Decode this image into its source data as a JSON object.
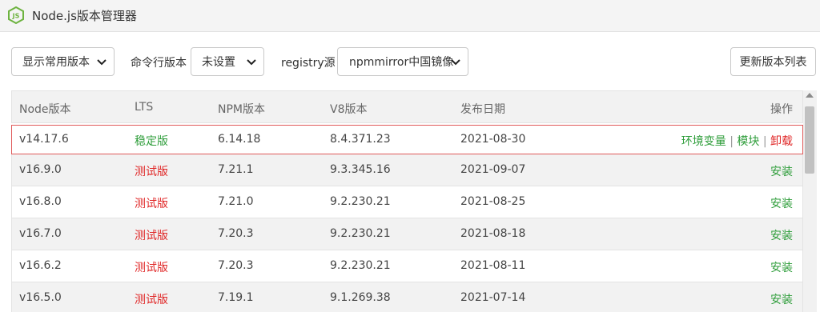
{
  "window": {
    "title": "Node.js版本管理器",
    "icon": "nodejs-hexagon-icon"
  },
  "toolbar": {
    "version_filter": "显示常用版本",
    "cli_label": "命令行版本",
    "cli_value": "未设置",
    "registry_label": "registry源",
    "registry_value": "npmmirror中国镜像",
    "refresh_label": "更新版本列表"
  },
  "table": {
    "headers": {
      "node": "Node版本",
      "lts": "LTS",
      "npm": "NPM版本",
      "v8": "V8版本",
      "date": "发布日期",
      "action": "操作"
    },
    "rows": [
      {
        "node": "v14.17.6",
        "lts": "稳定版",
        "npm": "6.14.18",
        "v8": "8.4.371.23",
        "date": "2021-08-30",
        "env": "环境变量",
        "module": "模块",
        "uninstall": "卸载",
        "sep1": "|",
        "sep2": "|"
      },
      {
        "node": "v16.9.0",
        "lts": "测试版",
        "npm": "7.21.1",
        "v8": "9.3.345.16",
        "date": "2021-09-07",
        "install": "安装"
      },
      {
        "node": "v16.8.0",
        "lts": "测试版",
        "npm": "7.21.0",
        "v8": "9.2.230.21",
        "date": "2021-08-25",
        "install": "安装"
      },
      {
        "node": "v16.7.0",
        "lts": "测试版",
        "npm": "7.20.3",
        "v8": "9.2.230.21",
        "date": "2021-08-18",
        "install": "安装"
      },
      {
        "node": "v16.6.2",
        "lts": "测试版",
        "npm": "7.20.3",
        "v8": "9.2.230.21",
        "date": "2021-08-11",
        "install": "安装"
      },
      {
        "node": "v16.5.0",
        "lts": "测试版",
        "npm": "7.19.1",
        "v8": "9.1.269.38",
        "date": "2021-07-14",
        "install": "安装"
      }
    ]
  },
  "colors": {
    "stable": "#2e9d3a",
    "beta": "#e02828",
    "action": "#2e9d3a",
    "selected_border": "#e05a5a"
  }
}
